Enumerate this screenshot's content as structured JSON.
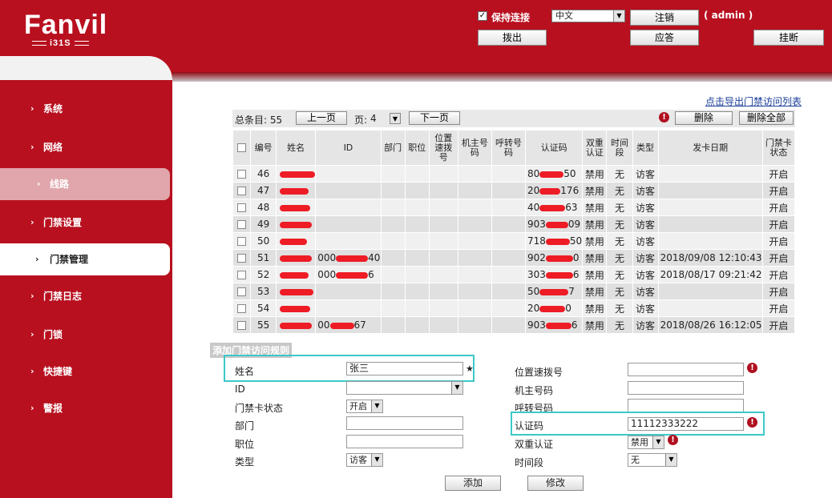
{
  "brand": {
    "logo": "Fanvil",
    "model": "i31S"
  },
  "header": {
    "keep_connection_label": "保持连接",
    "keep_connection_checked": true,
    "language": "中文",
    "logout_label": "注销",
    "user": "( admin )",
    "dial_out_label": "拨出",
    "answer_label": "应答",
    "hangup_label": "挂断"
  },
  "sidebar": {
    "items": [
      {
        "label": "系统"
      },
      {
        "label": "网络"
      },
      {
        "label": "线路"
      },
      {
        "label": "门禁设置"
      },
      {
        "label": "门禁管理"
      },
      {
        "label": "门禁日志"
      },
      {
        "label": "门锁"
      },
      {
        "label": "快捷键"
      },
      {
        "label": "警报"
      }
    ],
    "active": "门禁管理"
  },
  "list": {
    "export_link": "点击导出门禁访问列表",
    "total_label": "总条目: 55",
    "prev_label": "上一页",
    "page_label": "页:",
    "page_value": "4",
    "next_label": "下一页",
    "delete_label": "删除",
    "delete_all_label": "删除全部",
    "columns": [
      "编号",
      "姓名",
      "ID",
      "部门",
      "职位",
      "位置速拨号",
      "机主号码",
      "呼转号码",
      "认证码",
      "双重认证",
      "时间段",
      "类型",
      "发卡日期",
      "门禁卡状态"
    ],
    "rows": [
      {
        "no": "46",
        "id": "",
        "code_head": "80",
        "code_tail": "50",
        "dual": "禁用",
        "period": "无",
        "type": "访客",
        "date": "",
        "status": "开启"
      },
      {
        "no": "47",
        "id": "",
        "code_head": "20",
        "code_tail": "176",
        "dual": "禁用",
        "period": "无",
        "type": "访客",
        "date": "",
        "status": "开启"
      },
      {
        "no": "48",
        "id": "",
        "code_head": "40",
        "code_tail": "63",
        "dual": "禁用",
        "period": "无",
        "type": "访客",
        "date": "",
        "status": "开启"
      },
      {
        "no": "49",
        "id": "",
        "code_head": "903",
        "code_tail": "09",
        "dual": "禁用",
        "period": "无",
        "type": "访客",
        "date": "",
        "status": "开启"
      },
      {
        "no": "50",
        "id": "",
        "code_head": "718",
        "code_tail": "50",
        "dual": "禁用",
        "period": "无",
        "type": "访客",
        "date": "",
        "status": "开启"
      },
      {
        "no": "51",
        "id_head": "000",
        "id_tail": "40",
        "code_head": "902",
        "code_tail": "0",
        "dual": "禁用",
        "period": "无",
        "type": "访客",
        "date": "2018/09/08 12:10:43",
        "status": "开启"
      },
      {
        "no": "52",
        "id_head": "000",
        "id_tail": "6",
        "code_head": "303",
        "code_tail": "6",
        "dual": "禁用",
        "period": "无",
        "type": "访客",
        "date": "2018/08/17 09:21:42",
        "status": "开启"
      },
      {
        "no": "53",
        "id": "",
        "code_head": "50",
        "code_tail": "7",
        "dual": "禁用",
        "period": "无",
        "type": "访客",
        "date": "",
        "status": "开启"
      },
      {
        "no": "54",
        "id": "",
        "code_head": "20",
        "code_tail": "0",
        "dual": "禁用",
        "period": "无",
        "type": "访客",
        "date": "",
        "status": "开启"
      },
      {
        "no": "55",
        "id_head": "00",
        "id_tail": "67",
        "code_head": "903",
        "code_tail": "6",
        "dual": "禁用",
        "period": "无",
        "type": "访客",
        "date": "2018/08/26 16:12:05",
        "status": "开启"
      }
    ]
  },
  "form": {
    "title": "添加门禁访问规则",
    "name_label": "姓名",
    "name_value": "张三",
    "id_label": "ID",
    "id_value": "",
    "card_status_label": "门禁卡状态",
    "card_status_value": "开启",
    "dept_label": "部门",
    "dept_value": "",
    "position_label": "职位",
    "position_value": "",
    "type_label": "类型",
    "type_value": "访客",
    "speed_dial_label": "位置速拨号",
    "speed_dial_value": "",
    "owner_label": "机主号码",
    "owner_value": "",
    "forward_label": "呼转号码",
    "forward_value": "",
    "auth_label": "认证码",
    "auth_value": "11112333222",
    "dual_label": "双重认证",
    "dual_value": "禁用",
    "period_label": "时间段",
    "period_value": "无",
    "add_label": "添加",
    "modify_label": "修改"
  },
  "colors": {
    "brand": "#b8101f",
    "highlight": "#3dc8c8",
    "redaction": "#ee1c25"
  }
}
